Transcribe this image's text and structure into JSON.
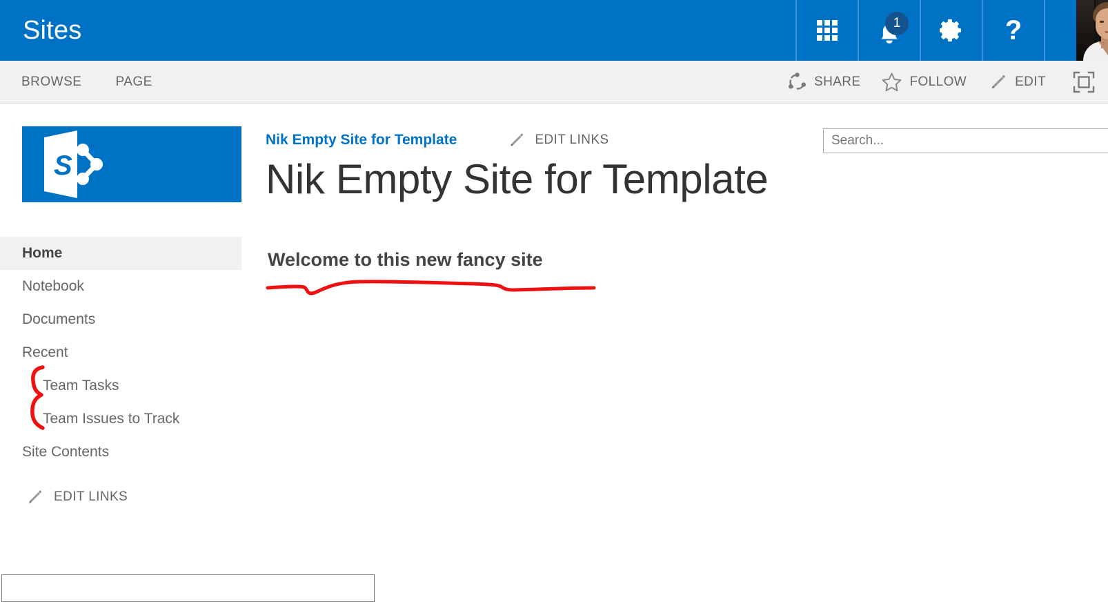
{
  "suite_bar": {
    "brand": "Sites",
    "app_launcher_icon": "waffle-grid-icon",
    "notifications_icon": "bell-icon",
    "notifications_count": "1",
    "settings_icon": "gear-icon",
    "help_icon": "question-mark-icon",
    "avatar_icon": "user-avatar-photo",
    "background_color": "#0072c6",
    "divider_color": "#3f93d4",
    "badge_color": "#14538e"
  },
  "ribbon": {
    "tabs": [
      {
        "label": "BROWSE"
      },
      {
        "label": "PAGE"
      }
    ],
    "actions": [
      {
        "label": "SHARE",
        "icon": "share-icon"
      },
      {
        "label": "FOLLOW",
        "icon": "star-outline-icon"
      },
      {
        "label": "EDIT",
        "icon": "pencil-icon"
      }
    ],
    "focus_icon": "focus-on-content-icon",
    "background_color": "#f1f1f1",
    "text_color": "#666666"
  },
  "site_logo": {
    "icon": "sharepoint-logo-icon",
    "letter": "S",
    "background_color": "#0072c6"
  },
  "left_nav": {
    "items": [
      {
        "label": "Home",
        "selected": true,
        "child": false
      },
      {
        "label": "Notebook",
        "selected": false,
        "child": false
      },
      {
        "label": "Documents",
        "selected": false,
        "child": false
      },
      {
        "label": "Recent",
        "selected": false,
        "child": false
      },
      {
        "label": "Team Tasks",
        "selected": false,
        "child": true
      },
      {
        "label": "Team Issues to Track",
        "selected": false,
        "child": true
      },
      {
        "label": "Site Contents",
        "selected": false,
        "child": false
      }
    ],
    "edit_links": {
      "label": "EDIT LINKS",
      "icon": "pencil-icon"
    },
    "selected_background": "#f1f1f1"
  },
  "main": {
    "breadcrumb": "Nik Empty Site for Template",
    "edit_links": {
      "label": "EDIT LINKS",
      "icon": "pencil-icon"
    },
    "page_title": "Nik Empty Site for Template",
    "welcome_heading": "Welcome to this new fancy site",
    "link_color": "#0072c6",
    "title_color": "#333333"
  },
  "search": {
    "placeholder": "Search...",
    "value": "",
    "icon": "search-magnifier-icon"
  },
  "annotations": {
    "color": "#ee1111",
    "underline": "hand-drawn-red-underline-under-welcome-heading",
    "brace": "hand-drawn-red-curly-brace-grouping-team-tasks-and-team-issues-to-track"
  }
}
